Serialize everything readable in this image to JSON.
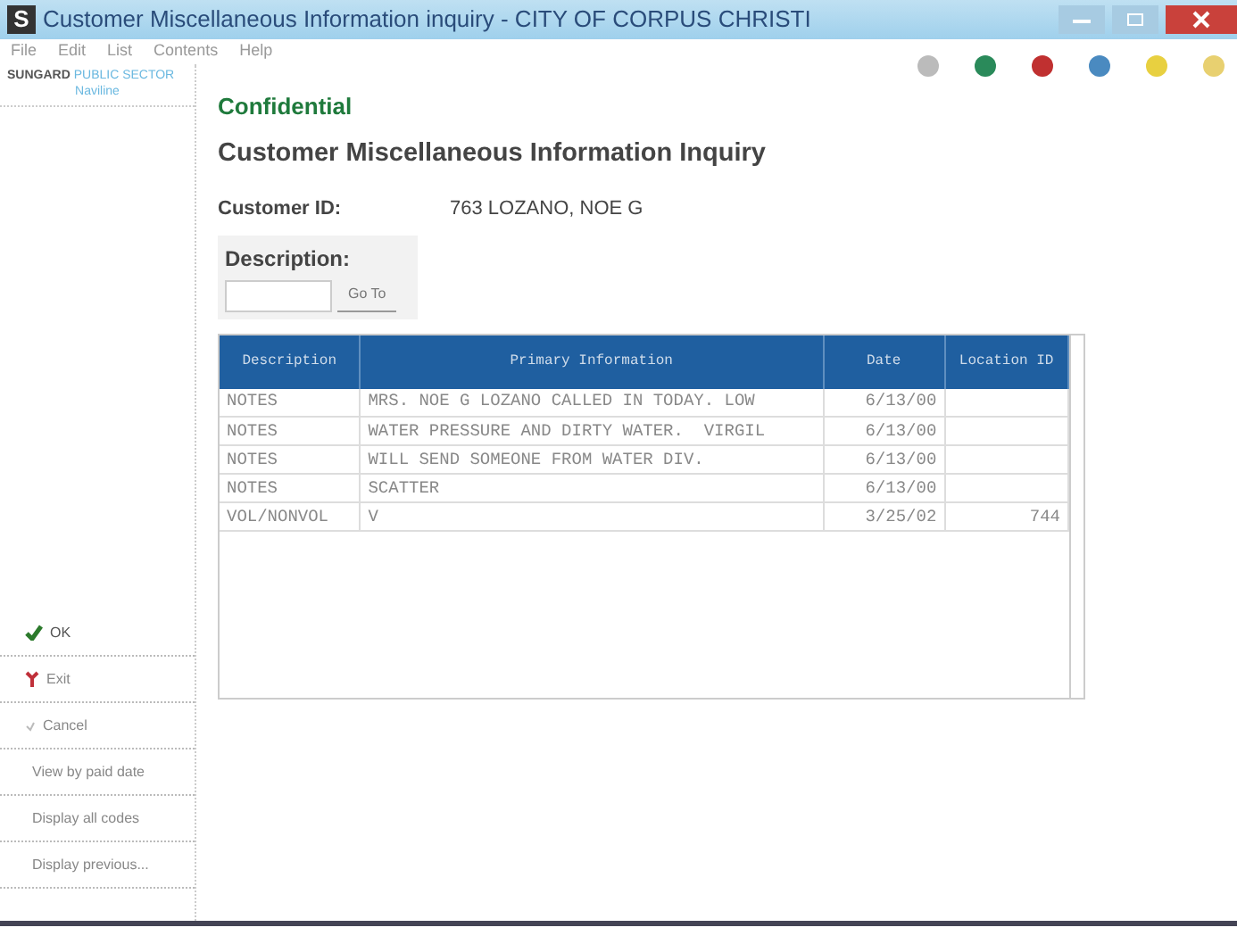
{
  "window": {
    "app_letter": "S",
    "title": "Customer Miscellaneous Information inquiry - CITY OF CORPUS CHRISTI"
  },
  "menu": [
    "File",
    "Edit",
    "List",
    "Contents",
    "Help"
  ],
  "logo": {
    "brand": "SUNGARD",
    "product": "PUBLIC SECTOR",
    "sub": "Naviline"
  },
  "sidebar_buttons": [
    {
      "kind": "ok",
      "label": "OK"
    },
    {
      "kind": "exit",
      "label": "Exit"
    },
    {
      "kind": "cancel",
      "label": "Cancel"
    },
    {
      "kind": "plain",
      "label": "View by paid date"
    },
    {
      "kind": "plain",
      "label": "Display all codes"
    },
    {
      "kind": "plain",
      "label": "Display previous..."
    }
  ],
  "confidential": "Confidential",
  "heading": "Customer Miscellaneous Information Inquiry",
  "customer_id": {
    "label": "Customer ID:",
    "value": "763 LOZANO, NOE G"
  },
  "description": {
    "label": "Description:",
    "button": "Go To"
  },
  "table": {
    "columns": [
      "Description",
      "Primary Information",
      "Date",
      "Location ID"
    ],
    "rows": [
      [
        "NOTES",
        "MRS. NOE G LOZANO CALLED IN TODAY. LOW",
        "6/13/00",
        ""
      ],
      [
        "NOTES",
        "WATER PRESSURE AND DIRTY WATER.  VIRGIL",
        "6/13/00",
        ""
      ],
      [
        "NOTES",
        "WILL SEND SOMEONE FROM WATER DIV.",
        "6/13/00",
        ""
      ],
      [
        "NOTES",
        "SCATTER",
        "6/13/00",
        ""
      ],
      [
        "VOL/NONVOL",
        "V",
        "3/25/02",
        "744"
      ]
    ]
  }
}
